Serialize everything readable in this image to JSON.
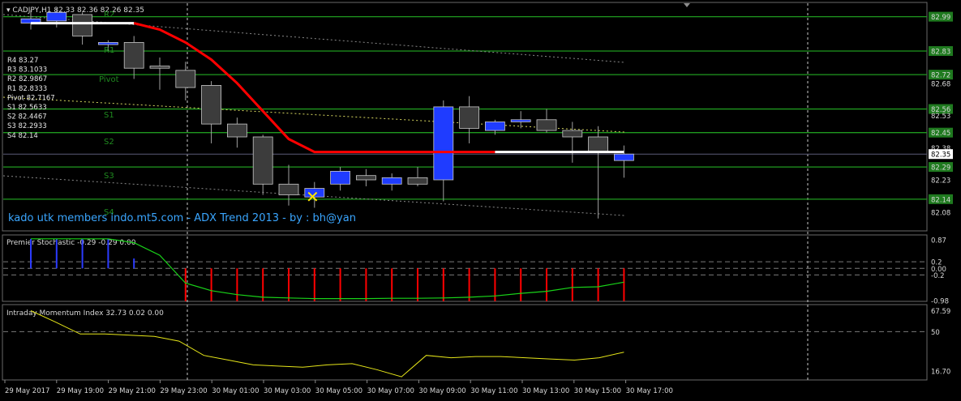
{
  "main": {
    "header": "CADJPY,H1  82.33 82.36 82.26 82.35",
    "watermark": "kado utk members indo.mt5.com - ADX Trend 2013 - by : bh@yan",
    "price_labels": [
      "82.99",
      "82.83",
      "82.68",
      "82.72",
      "82.56",
      "82.53",
      "82.45",
      "82.38",
      "82.35",
      "82.29",
      "82.23",
      "82.14",
      "82.08"
    ],
    "highlighted_price": "82.35",
    "pivot_labels": [
      "R4 83.27",
      "R3 83.1033",
      "R2 82.9867",
      "R1 82.8333",
      "Pivot 82.7167",
      "S1 82.5633",
      "S2 82.4467",
      "S3 82.2933",
      "S4 82.14"
    ],
    "line_names": [
      "R2",
      "R1",
      "Pivot",
      "S1",
      "S2",
      "S3",
      "S4"
    ]
  },
  "stoch": {
    "header": "Premier Stochastic -0.29 -0.29 0.00",
    "axis_labels": [
      "0.87",
      "0.2",
      "0.00",
      "-0.2",
      "-0.98"
    ]
  },
  "momentum": {
    "header": "Intraday Momentum Index 32.73 0.02 0.00",
    "axis_labels": [
      "67.59",
      "50",
      "16.70"
    ]
  },
  "time_labels": [
    "29 May 2017",
    "29 May 19:00",
    "29 May 21:00",
    "29 May 23:00",
    "30 May 01:00",
    "30 May 03:00",
    "30 May 05:00",
    "30 May 07:00",
    "30 May 09:00",
    "30 May 11:00",
    "30 May 13:00",
    "30 May 15:00",
    "30 May 17:00"
  ],
  "colors": {
    "bull": "#1f3cff",
    "bear": "#3c3c3c",
    "level_line": "#1f9a1f",
    "trend_down": "#ff0000",
    "trend_flat": "#ffffff",
    "stoch_line": "#19d419",
    "stoch_down_bar": "#ff0000",
    "stoch_up_bar": "#2b3bff",
    "momentum_line": "#e6e619",
    "marker": "#ffe600"
  },
  "chart_data": {
    "type": "candlestick",
    "candles": [
      {
        "o": 82.96,
        "h": 83.02,
        "l": 82.93,
        "c": 82.98
      },
      {
        "o": 82.97,
        "h": 83.03,
        "l": 82.94,
        "c": 83.01
      },
      {
        "o": 83.0,
        "h": 83.01,
        "l": 82.86,
        "c": 82.9
      },
      {
        "o": 82.86,
        "h": 82.88,
        "l": 82.83,
        "c": 82.87
      },
      {
        "o": 82.87,
        "h": 82.9,
        "l": 82.7,
        "c": 82.75
      },
      {
        "o": 82.76,
        "h": 82.8,
        "l": 82.65,
        "c": 82.75
      },
      {
        "o": 82.74,
        "h": 82.78,
        "l": 82.6,
        "c": 82.66
      },
      {
        "o": 82.67,
        "h": 82.69,
        "l": 82.4,
        "c": 82.49
      },
      {
        "o": 82.49,
        "h": 82.52,
        "l": 82.38,
        "c": 82.43
      },
      {
        "o": 82.43,
        "h": 82.44,
        "l": 82.16,
        "c": 82.21
      },
      {
        "o": 82.21,
        "h": 82.3,
        "l": 82.11,
        "c": 82.16
      },
      {
        "o": 82.15,
        "h": 82.22,
        "l": 82.1,
        "c": 82.19
      },
      {
        "o": 82.21,
        "h": 82.29,
        "l": 82.18,
        "c": 82.27
      },
      {
        "o": 82.25,
        "h": 82.28,
        "l": 82.2,
        "c": 82.23
      },
      {
        "o": 82.21,
        "h": 82.26,
        "l": 82.18,
        "c": 82.24
      },
      {
        "o": 82.24,
        "h": 82.29,
        "l": 82.2,
        "c": 82.21
      },
      {
        "o": 82.23,
        "h": 82.6,
        "l": 82.13,
        "c": 82.57
      },
      {
        "o": 82.57,
        "h": 82.62,
        "l": 82.4,
        "c": 82.47
      },
      {
        "o": 82.46,
        "h": 82.51,
        "l": 82.44,
        "c": 82.5
      },
      {
        "o": 82.5,
        "h": 82.55,
        "l": 82.47,
        "c": 82.51
      },
      {
        "o": 82.51,
        "h": 82.56,
        "l": 82.45,
        "c": 82.46
      },
      {
        "o": 82.46,
        "h": 82.5,
        "l": 82.31,
        "c": 82.43
      },
      {
        "o": 82.43,
        "h": 82.48,
        "l": 82.05,
        "c": 82.36
      },
      {
        "o": 82.32,
        "h": 82.39,
        "l": 82.24,
        "c": 82.35
      }
    ],
    "trend_line": [
      82.96,
      82.96,
      82.96,
      82.96,
      82.96,
      82.93,
      82.87,
      82.79,
      82.68,
      82.55,
      82.42,
      82.36,
      82.36,
      82.36,
      82.36,
      82.36,
      82.36,
      82.36,
      82.36,
      82.36,
      82.36,
      82.36,
      82.36,
      82.36
    ],
    "levels": [
      82.99,
      82.83,
      82.72,
      82.56,
      82.45,
      82.29,
      82.14
    ],
    "stoch_line": [
      0.9,
      0.9,
      0.9,
      0.9,
      0.78,
      0.4,
      -0.45,
      -0.68,
      -0.8,
      -0.88,
      -0.9,
      -0.92,
      -0.92,
      -0.92,
      -0.91,
      -0.91,
      -0.9,
      -0.88,
      -0.84,
      -0.76,
      -0.7,
      -0.58,
      -0.56,
      -0.42
    ],
    "stoch_bars": [
      0.9,
      0.9,
      0.9,
      0.9,
      0.3,
      0.0,
      -1,
      -1,
      -1,
      -1,
      -1,
      -1,
      -1,
      -1,
      -1,
      -1,
      -1,
      -1,
      -1,
      -1,
      -1,
      -1,
      -1,
      -1
    ],
    "momentum_line": [
      67.59,
      58,
      48,
      48,
      47,
      46,
      42,
      30,
      26,
      22,
      21,
      20,
      22,
      23,
      18,
      12,
      30,
      28,
      29,
      29,
      28,
      27,
      26,
      28,
      32.73
    ],
    "price_range": [
      82.03,
      83.03
    ],
    "stoch_range": [
      -0.98,
      0.87
    ],
    "momentum_range": [
      10,
      70
    ]
  }
}
